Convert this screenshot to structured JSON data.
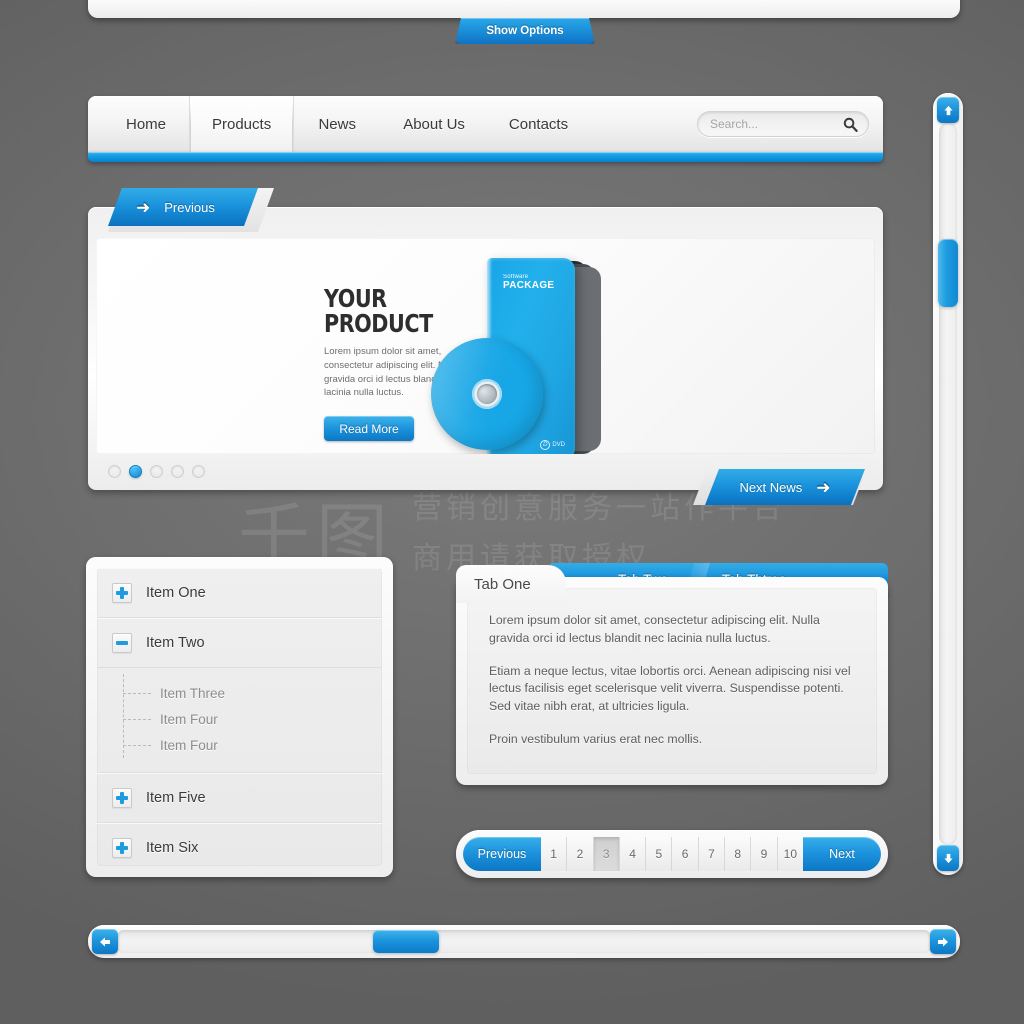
{
  "colors": {
    "accent_blue": "#1b93dc",
    "accent_blue_light": "#36afe9",
    "accent_blue_dark": "#0d77c4",
    "page_background": "#6e6e6e",
    "panel_light": "#fcfcfc",
    "text_dark": "#3b3b3b",
    "text_muted": "#8d8d8d"
  },
  "watermark": {
    "logo": "千图",
    "line1": "营销创意服务一站作平台",
    "line2": "商用请获取授权"
  },
  "top_panel": {
    "show_options_label": "Show Options"
  },
  "nav": {
    "items": [
      {
        "label": "Home",
        "active": false
      },
      {
        "label": "Products",
        "active": true
      },
      {
        "label": "News",
        "active": false
      },
      {
        "label": "About Us",
        "active": false
      },
      {
        "label": "Contacts",
        "active": false
      }
    ],
    "search": {
      "placeholder": "Search...",
      "value": "",
      "icon": "search-icon"
    }
  },
  "slider": {
    "previous_label": "Previous",
    "previous_icon": "arrow-left-icon",
    "next_label": "Next News",
    "next_icon": "arrow-right-icon",
    "slide": {
      "title": "YOUR PRODUCT",
      "description": "Lorem ipsum dolor sit amet, consectetur adipiscing elit. Nulla gravida orci id lectus blandit nec lacinia nulla luctus.",
      "cta_label": "Read More"
    },
    "product_art": {
      "package_label_small": "Software",
      "package_label_big": "PACKAGE",
      "package_footer": "DVD",
      "package_footer_mark": "D"
    },
    "dots": [
      {
        "active": false
      },
      {
        "active": true
      },
      {
        "active": false
      },
      {
        "active": false
      },
      {
        "active": false
      }
    ]
  },
  "accordion": {
    "rows": [
      {
        "label": "Item One",
        "state": "plus"
      },
      {
        "label": "Item Two",
        "state": "minus"
      }
    ],
    "sub_items": [
      {
        "label": "Item Three"
      },
      {
        "label": "Item Four"
      },
      {
        "label": "Item Four"
      }
    ],
    "rows_after": [
      {
        "label": "Item Five",
        "state": "plus"
      },
      {
        "label": "Item Six",
        "state": "plus"
      }
    ]
  },
  "tabs": {
    "items": [
      {
        "label": "Tab One",
        "active": true
      },
      {
        "label": "Tab Two",
        "active": false
      },
      {
        "label": "Tab Thtree",
        "active": false
      }
    ],
    "content": {
      "paragraph1": "Lorem ipsum dolor sit amet, consectetur adipiscing elit. Nulla gravida orci id lectus blandit nec lacinia nulla luctus.",
      "paragraph2": "Etiam a neque lectus, vitae lobortis orci. Aenean adipiscing nisi vel lectus facilisis eget scelerisque velit viverra. Suspendisse potenti. Sed vitae nibh erat, at ultricies ligula.",
      "paragraph3": "Proin vestibulum varius erat nec mollis."
    }
  },
  "pagination": {
    "previous_label": "Previous",
    "next_label": "Next",
    "pages": [
      {
        "label": "1",
        "active": false
      },
      {
        "label": "2",
        "active": false
      },
      {
        "label": "3",
        "active": true
      },
      {
        "label": "4",
        "active": false
      },
      {
        "label": "5",
        "active": false
      },
      {
        "label": "6",
        "active": false
      },
      {
        "label": "7",
        "active": false
      },
      {
        "label": "8",
        "active": false
      },
      {
        "label": "9",
        "active": false
      },
      {
        "label": "10",
        "active": false
      }
    ]
  },
  "scrollbars": {
    "vertical": {
      "up_icon": "arrow-up-icon",
      "down_icon": "arrow-down-icon",
      "thumb_position_percent": 16
    },
    "horizontal": {
      "left_icon": "arrow-left-icon",
      "right_icon": "arrow-right-icon",
      "thumb_position_percent": 33
    }
  }
}
